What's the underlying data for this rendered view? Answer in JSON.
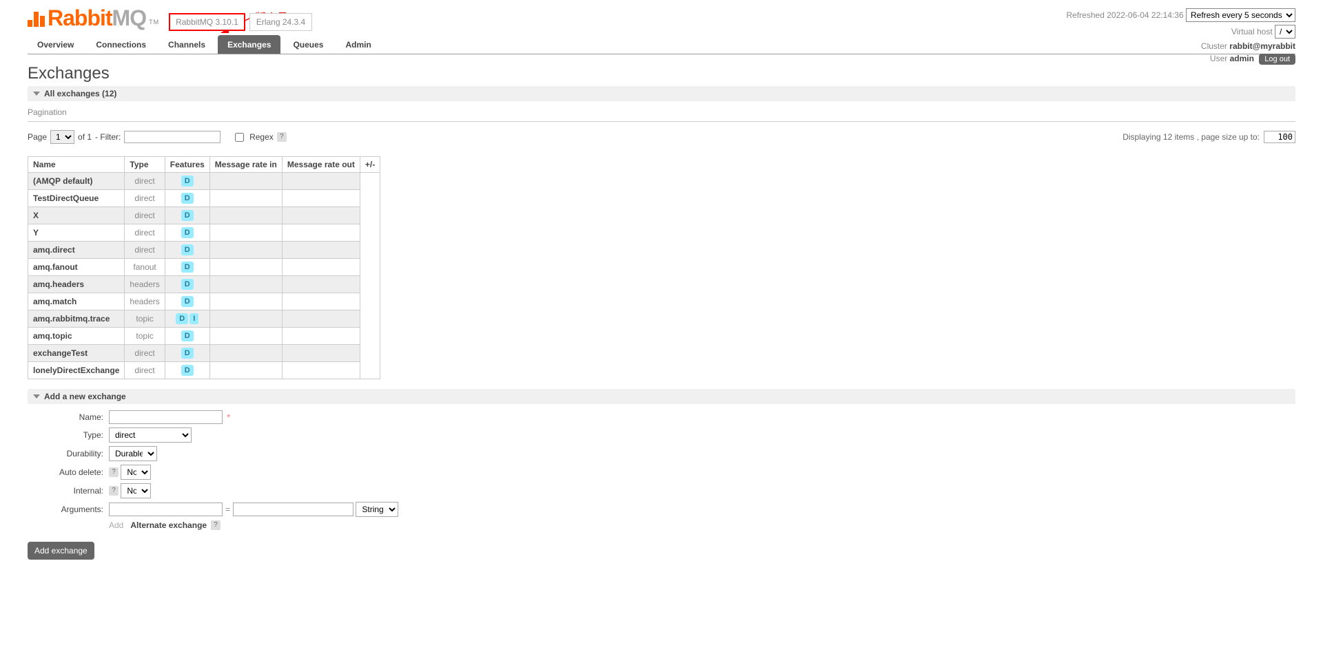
{
  "annotation": {
    "label": "版本号"
  },
  "logo": {
    "part1": "Rabbit",
    "part2": "MQ",
    "tm": "TM"
  },
  "versions": {
    "rabbitmq": "RabbitMQ 3.10.1",
    "erlang": "Erlang 24.3.4"
  },
  "topRight": {
    "refreshedLabel": "Refreshed",
    "refreshedTime": "2022-06-04 22:14:36",
    "refreshSelect": "Refresh every 5 seconds",
    "vhostLabel": "Virtual host",
    "vhostValue": "/",
    "clusterLabel": "Cluster",
    "clusterValue": "rabbit@myrabbit",
    "userLabel": "User",
    "userValue": "admin",
    "logout": "Log out"
  },
  "tabs": {
    "overview": "Overview",
    "connections": "Connections",
    "channels": "Channels",
    "exchanges": "Exchanges",
    "queues": "Queues",
    "admin": "Admin"
  },
  "pageTitle": "Exchanges",
  "sectionAll": "All exchanges (12)",
  "paginationLabel": "Pagination",
  "pager": {
    "pageLabel": "Page",
    "pageValue": "1",
    "ofLabel": "of 1",
    "filterLabel": "- Filter:",
    "regexLabel": "Regex",
    "help": "?",
    "displaying": "Displaying 12 items , page size up to:",
    "pageSize": "100"
  },
  "table": {
    "headers": {
      "name": "Name",
      "type": "Type",
      "features": "Features",
      "rateIn": "Message rate in",
      "rateOut": "Message rate out",
      "pm": "+/-"
    },
    "rows": [
      {
        "name": "(AMQP default)",
        "type": "direct",
        "features": [
          "D"
        ]
      },
      {
        "name": "TestDirectQueue",
        "type": "direct",
        "features": [
          "D"
        ]
      },
      {
        "name": "X",
        "type": "direct",
        "features": [
          "D"
        ]
      },
      {
        "name": "Y",
        "type": "direct",
        "features": [
          "D"
        ]
      },
      {
        "name": "amq.direct",
        "type": "direct",
        "features": [
          "D"
        ]
      },
      {
        "name": "amq.fanout",
        "type": "fanout",
        "features": [
          "D"
        ]
      },
      {
        "name": "amq.headers",
        "type": "headers",
        "features": [
          "D"
        ]
      },
      {
        "name": "amq.match",
        "type": "headers",
        "features": [
          "D"
        ]
      },
      {
        "name": "amq.rabbitmq.trace",
        "type": "topic",
        "features": [
          "D",
          "I"
        ]
      },
      {
        "name": "amq.topic",
        "type": "topic",
        "features": [
          "D"
        ]
      },
      {
        "name": "exchangeTest",
        "type": "direct",
        "features": [
          "D"
        ]
      },
      {
        "name": "lonelyDirectExchange",
        "type": "direct",
        "features": [
          "D"
        ]
      }
    ]
  },
  "sectionAdd": "Add a new exchange",
  "form": {
    "nameLabel": "Name:",
    "typeLabel": "Type:",
    "typeValue": "direct",
    "durabilityLabel": "Durability:",
    "durabilityValue": "Durable",
    "autoDeleteLabel": "Auto delete:",
    "autoDeleteValue": "No",
    "internalLabel": "Internal:",
    "internalValue": "No",
    "argumentsLabel": "Arguments:",
    "argTypeValue": "String",
    "addHint": "Add",
    "altExchange": "Alternate exchange",
    "help": "?",
    "submit": "Add exchange",
    "mand": "*"
  }
}
